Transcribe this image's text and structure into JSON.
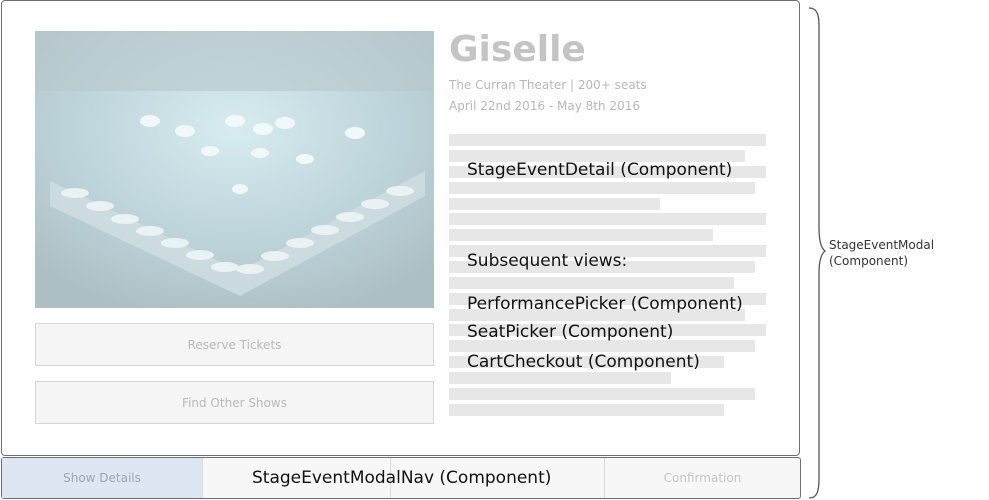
{
  "event": {
    "title": "Giselle",
    "venue": "The Curran Theater | 200+ seats",
    "dates": "April 22nd 2016 - May 8th 2016"
  },
  "buttons": {
    "reserve": "Reserve Tickets",
    "find_other": "Find Other Shows"
  },
  "annotations": {
    "detail_component": "StageEventDetail (Component)",
    "subsequent_heading": "Subsequent views:",
    "views": [
      "PerformancePicker (Component)",
      "SeatPicker (Component)",
      "CartCheckout (Component)"
    ],
    "nav_component": "StageEventModalNav (Component)",
    "modal_component_line1": "StageEventModal",
    "modal_component_line2": "(Component)"
  },
  "nav": {
    "tabs": [
      "Show Details",
      "",
      "",
      "Confirmation"
    ],
    "active_index": 0
  }
}
